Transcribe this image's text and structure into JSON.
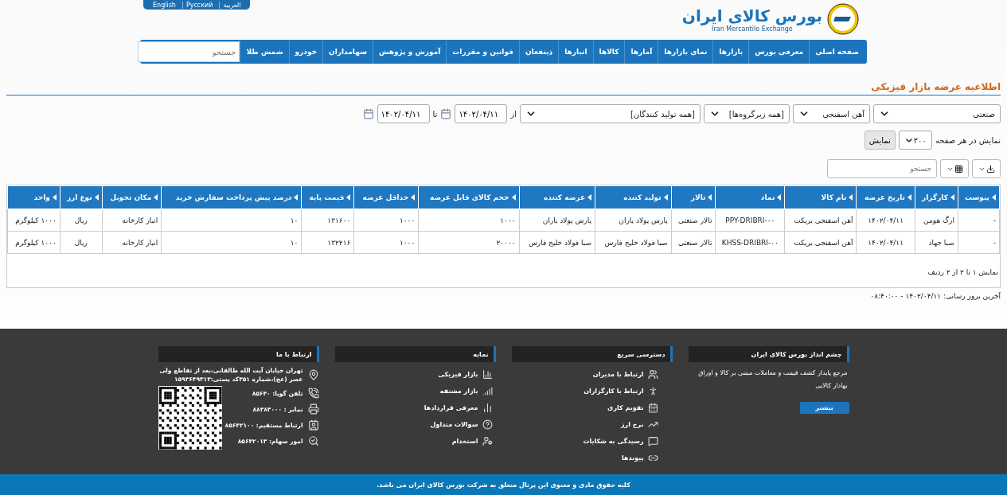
{
  "top_links": [
    {
      "label": "العربية"
    },
    {
      "label": "Pусский"
    },
    {
      "label": "English"
    }
  ],
  "logo": {
    "title": "بورس کالای ایران",
    "subtitle": "Iran Mercantile Exchange"
  },
  "nav": {
    "items": [
      "صفحه اصلی",
      "معرفی بورس",
      "بازارها",
      "نمای بازارها",
      "آمارها",
      "کالاها",
      "انبارها",
      "ذینفعان",
      "قوانین و مقررات",
      "آموزش و پژوهش",
      "سهامداران",
      "خودرو",
      "شمش طلا"
    ],
    "search": {
      "placeholder": "جستجو"
    }
  },
  "page_title": "اطلاعیه عرضه بازار فیزیکی",
  "filters": {
    "selects": [
      {
        "value": "صنعتی"
      },
      {
        "value": "آهن اسفنجی"
      },
      {
        "value": "[همه زیرگروه‌ها]"
      },
      {
        "value": "[همه تولید کنندگان]"
      }
    ],
    "from_label": "از",
    "from_date": "۱۴۰۲/۰۴/۱۱",
    "to_label": "تا",
    "to_date": "۱۴۰۲/۰۴/۱۱"
  },
  "page_size": {
    "label": "نمایش در هر صفحه",
    "value": "۲۰۰",
    "button": "نمایش"
  },
  "table": {
    "search": {
      "placeholder": "جستجو"
    },
    "columns": [
      "پیوست",
      "کارگزار",
      "تاریخ عرضه",
      "نام کالا",
      "نماد",
      "تالار",
      "تولید کننده",
      "عرضه کننده",
      "حجم کالای قابل عرضه",
      "حداقل عرضه",
      "قیمت پایه",
      "درصد پیش پرداخت سفارش خرید",
      "مکان تحویل",
      "نوع ارز",
      "واحد"
    ],
    "rows": [
      [
        "-",
        "ارگ هومن",
        "۱۴۰۲/۰۴/۱۱",
        "آهن اسفنجی بریکت",
        "PPY-DRIBRI-۰۰",
        "تالار صنعتی",
        "پارس پولاد یاران",
        "پارس پولاد یاران",
        "۱۰۰۰",
        "۱۰۰۰",
        "۱۳۱۶۰۰",
        "۱۰",
        "انبار کارخانه",
        "ریال",
        "۱۰۰۰ کیلوگرم"
      ],
      [
        "-",
        "صبا جهاد",
        "۱۴۰۲/۰۴/۱۱",
        "آهن اسفنجی بریکت",
        "KHSS-DRIBRI-۰۰",
        "تالار صنعتی",
        "صبا فولاد خلیج فارس",
        "صبا فولاد خلیج فارس",
        "۲۰۰۰۰",
        "۱۰۰۰",
        "۱۳۲۲۱۶",
        "۱۰",
        "انبار کارخانه",
        "ریال",
        "۱۰۰۰ کیلوگرم"
      ]
    ],
    "summary": "نمایش ۱ تا ۲ از ۲ ردیف"
  },
  "last_update": "آخرین بروز رسانی: ۱۴۰۲/۰۴/۱۱ - ۰۸:۴۰:۰۰",
  "footer": {
    "columns": [
      {
        "kind": "text",
        "title": "چشم انداز بورس کالای ایران",
        "text": "مرجع پایدار کشف قیمت و معاملات مبتنی بر کالا و اوراق بهادار کالایی",
        "button": "بیشتر"
      },
      {
        "kind": "links",
        "title": "دسترسی سریع",
        "items": [
          "ارتباط با مدیران",
          "ارتباط با کارگزاران",
          "تقویم کاری",
          "نرخ ارز",
          "رسیدگی به شکایات",
          "پیوندها"
        ]
      },
      {
        "kind": "links",
        "title": "نمایه",
        "items": [
          "بازار فیزیکی",
          "بازار مشتقه",
          "معرفی قراردادها",
          "سوالات متداول",
          "استخدام"
        ]
      },
      {
        "kind": "contact",
        "title": "ارتباط با ما",
        "items": [
          "تهران خیابان آیت الله طالقانی،بعد از تقاطع ولی عصر (عج)،شماره ۳۵۱کد پستی:۱۵۹۳۶۴۹۳۱۳",
          "تلفن گویا: ۸۵۶۴۰",
          "نمابر : ۸۸۳۸۳۰۰۰",
          "ارتباط مستقیم: ۸۵۶۴۲۱۰۰",
          "امور سهام: ۸۵۶۴۲۰۱۳"
        ]
      }
    ]
  },
  "copyright": "کلیه حقوق مادی و معنوی این پرتال متعلق به شرکت بورس کالای ایران می باشد."
}
